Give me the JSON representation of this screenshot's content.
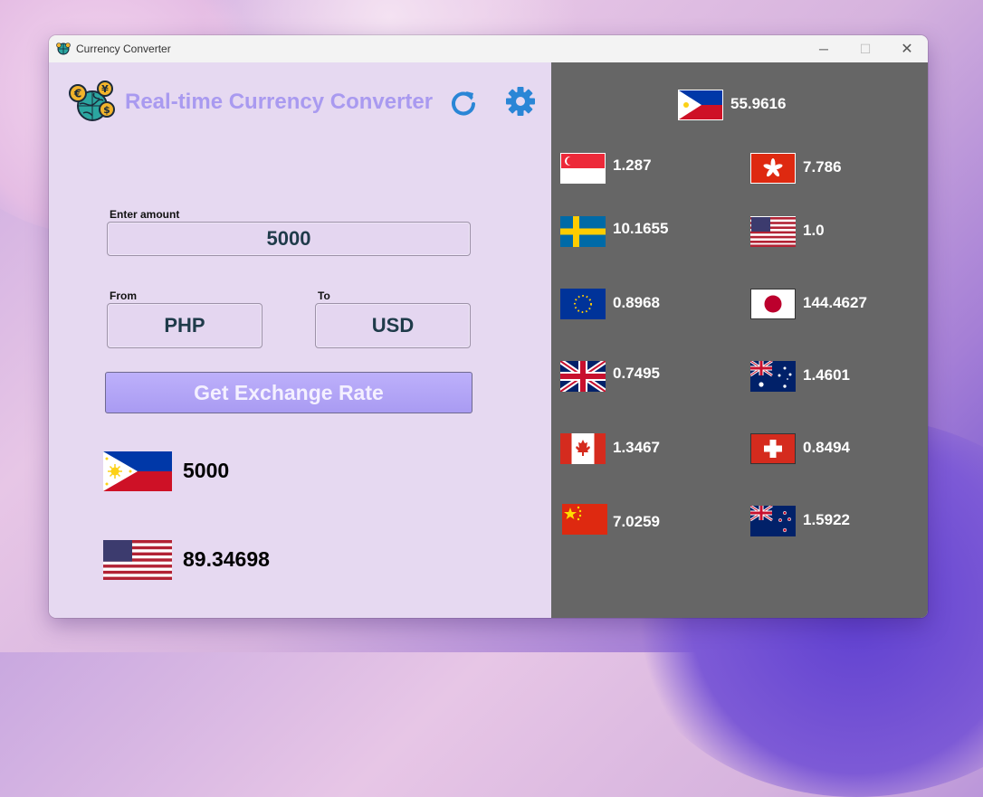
{
  "window": {
    "title": "Currency Converter",
    "controls": {
      "minimize": "─",
      "maximize": "☐",
      "close": "✕"
    }
  },
  "header": {
    "title": "Real-time Currency Converter",
    "refresh_icon": "refresh-icon",
    "settings_icon": "gear-icon"
  },
  "form": {
    "amount_label": "Enter amount",
    "amount_value": "5000",
    "from_label": "From",
    "from_value": "PHP",
    "to_label": "To",
    "to_value": "USD",
    "button_label": "Get Exchange Rate"
  },
  "result": {
    "from_flag": "flag-ph",
    "from_amount": "5000",
    "to_flag": "flag-us",
    "to_amount": "89.34698"
  },
  "rates_panel": {
    "base": {
      "flag": "flag-ph",
      "value": "55.9616"
    },
    "rates": [
      {
        "flag": "flag-sg",
        "value": "1.287"
      },
      {
        "flag": "flag-hk",
        "value": "7.786"
      },
      {
        "flag": "flag-se",
        "value": "10.1655"
      },
      {
        "flag": "flag-us",
        "value": "1.0"
      },
      {
        "flag": "flag-eu",
        "value": "0.8968"
      },
      {
        "flag": "flag-jp",
        "value": "144.4627"
      },
      {
        "flag": "flag-gb",
        "value": "0.7495"
      },
      {
        "flag": "flag-au",
        "value": "1.4601"
      },
      {
        "flag": "flag-ca",
        "value": "1.3467"
      },
      {
        "flag": "flag-ch",
        "value": "0.8494"
      },
      {
        "flag": "flag-cn",
        "value": "7.0259"
      },
      {
        "flag": "flag-nz",
        "value": "1.5922"
      }
    ]
  },
  "colors": {
    "accent": "#a99af0",
    "panel_bg": "#e6d9f1",
    "rates_bg": "#666666",
    "icon_blue": "#2a86d6"
  }
}
